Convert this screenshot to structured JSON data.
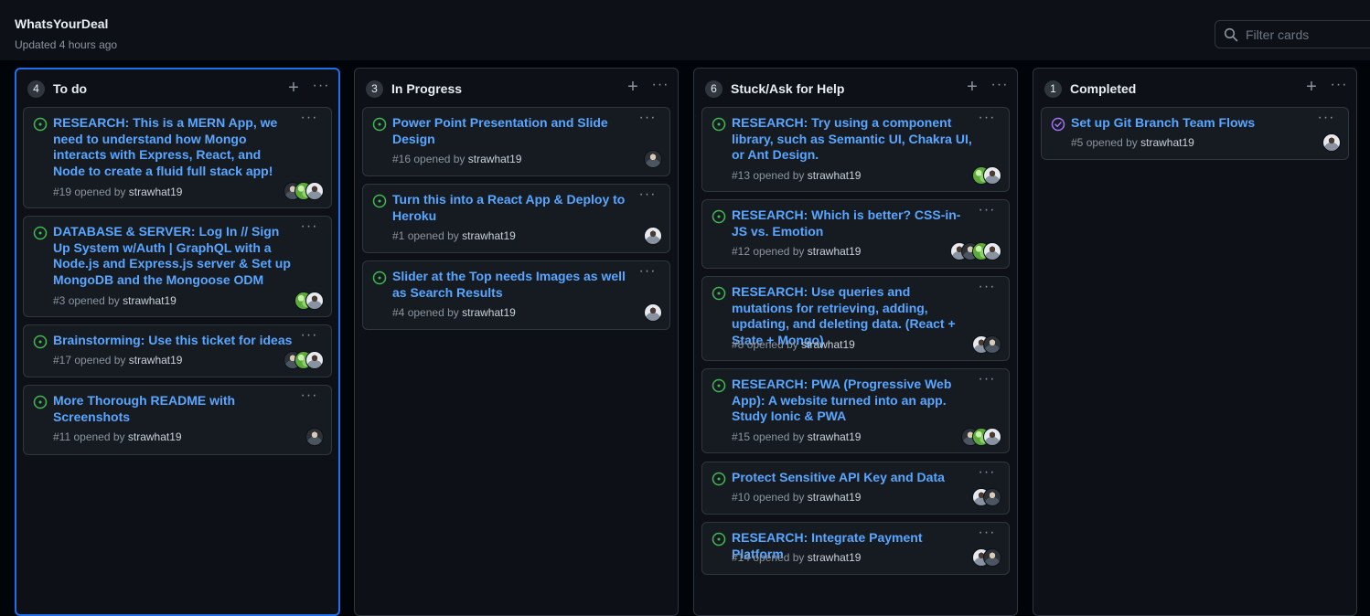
{
  "board": {
    "title": "WhatsYourDeal",
    "updated": "Updated 4 hours ago",
    "filter_placeholder": "Filter cards"
  },
  "colors": {
    "background": "#010409",
    "column_bg": "#0d1117",
    "card_bg": "#161b22",
    "link_blue": "#58a6ff",
    "open_green": "#3fb950",
    "closed_purple": "#a371f7",
    "selected_border": "#1f6feb"
  },
  "columns": [
    {
      "count": "4",
      "title": "To do",
      "cards": [
        {
          "title": "RESEARCH: This is a MERN App, we need to understand how Mongo interacts with Express, React, and Node to create a fluid full stack app!",
          "number": "#19",
          "opened_by": "opened by",
          "author": "strawhat19",
          "state": "open"
        },
        {
          "title": "DATABASE & SERVER: Log In // Sign Up System w/Auth | GraphQL with a Node.js and Express.js server & Set up MongoDB and the Mongoose ODM",
          "number": "#3",
          "opened_by": "opened by",
          "author": "strawhat19",
          "state": "open"
        },
        {
          "title": "Brainstorming: Use this ticket for ideas",
          "number": "#17",
          "opened_by": "opened by",
          "author": "strawhat19",
          "state": "open"
        },
        {
          "title": "More Thorough README with Screenshots",
          "number": "#11",
          "opened_by": "opened by",
          "author": "strawhat19",
          "state": "open"
        }
      ]
    },
    {
      "count": "3",
      "title": "In Progress",
      "cards": [
        {
          "title": "Power Point Presentation and Slide Design",
          "number": "#16",
          "opened_by": "opened by",
          "author": "strawhat19",
          "state": "open"
        },
        {
          "title": "Turn this into a React App & Deploy to Heroku",
          "number": "#1",
          "opened_by": "opened by",
          "author": "strawhat19",
          "state": "open"
        },
        {
          "title": "Slider at the Top needs Images as well as Search Results",
          "number": "#4",
          "opened_by": "opened by",
          "author": "strawhat19",
          "state": "open"
        }
      ]
    },
    {
      "count": "6",
      "title": "Stuck/Ask for Help",
      "cards": [
        {
          "title": "RESEARCH: Try using a component library, such as Semantic UI, Chakra UI, or Ant Design.",
          "number": "#13",
          "opened_by": "opened by",
          "author": "strawhat19",
          "state": "open"
        },
        {
          "title": "RESEARCH: Which is better? CSS-in-JS vs. Emotion",
          "number": "#12",
          "opened_by": "opened by",
          "author": "strawhat19",
          "state": "open"
        },
        {
          "title": "RESEARCH: Use queries and mutations for retrieving, adding, updating, and deleting data. (React + State + Mongo)",
          "number": "#8",
          "opened_by": "opened by",
          "author": "strawhat19",
          "state": "open"
        },
        {
          "title": "RESEARCH: PWA (Progressive Web App): A website turned into an app. Study Ionic & PWA",
          "number": "#15",
          "opened_by": "opened by",
          "author": "strawhat19",
          "state": "open"
        },
        {
          "title": "Protect Sensitive API Key and Data",
          "number": "#10",
          "opened_by": "opened by",
          "author": "strawhat19",
          "state": "open"
        },
        {
          "title": "RESEARCH: Integrate Payment Platform",
          "number": "#14",
          "opened_by": "opened by",
          "author": "strawhat19",
          "state": "open"
        }
      ]
    },
    {
      "count": "1",
      "title": "Completed",
      "cards": [
        {
          "title": "Set up Git Branch Team Flows",
          "number": "#5",
          "opened_by": "opened by",
          "author": "strawhat19",
          "state": "closed"
        }
      ]
    }
  ]
}
